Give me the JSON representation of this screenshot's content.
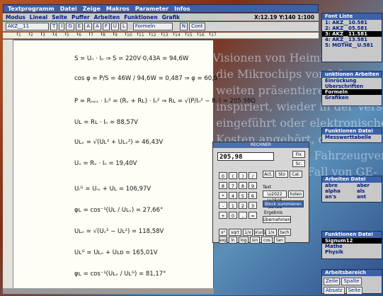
{
  "menu": {
    "items": [
      "Textprogramm",
      "Datei",
      "Zeige",
      "Makros",
      "Parameter",
      "Infos"
    ]
  },
  "toolbar1": {
    "items": [
      "Modus",
      "Lineal",
      "Seite",
      "Puffer",
      "Arbeiten",
      "Funktionen",
      "Grafik"
    ],
    "coords": "X:12.19    Y:140    1:100"
  },
  "toolbar2": {
    "style": "AKZ__11",
    "buttons": [
      "T",
      "I",
      "G",
      "E",
      "A",
      "A",
      "F",
      "U",
      "L"
    ],
    "mode": "Formeln",
    "misc": [
      "N",
      "Cont"
    ]
  },
  "ruler": {
    "labels": [
      "1",
      "2",
      "3",
      "4",
      "5",
      "6",
      "7",
      "8",
      "9",
      "10",
      "11",
      "12",
      "13",
      "14",
      "15",
      "16",
      "17"
    ]
  },
  "equations": [
    "S = Uₙ · Iₙ   ⇒   S = 220V·0,43A = 94,6W",
    "cos φ = P/S = 46W / 94,6W = 0,487 ⇒ φ = 60,9°",
    "P = Rₙₑₓ · Iₙ² = (Rᵥ + Rʟ) · Iₙ² ⇒ Rʟ = √(P/Iₙ² − Rᵥ) = 205,98Ω",
    "Uʟ = Rʟ · Iₙ = 88,57V",
    "Uʟᵥ = √(Uʟ² + Uʟᵥ²) = 46,43V",
    "Uᵥ = Rᵥ · Iₙ = 19,40V",
    "Uᵣᴳ = Uᵣᵥ + Uʟ = 106,97V",
    "φʟ = cos⁻¹(Uʟ / Uʟᵥ) = 27,66°",
    "Uʟᵥ = √(Uᵥ² − Uʟ²) = 118,58V",
    "Uʟᴳ = Uʟᵥ + Uʟᴅ = 165,01V",
    "φʟ = cos⁻¹(Uʟᵥ / Uʟᴳ) = 81,17°"
  ],
  "calculator": {
    "title": "RECHNER",
    "display": "205,98",
    "side_buttons": [
      "Fix",
      "Sc."
    ],
    "keys": [
      "0",
      "(",
      ")",
      "/",
      "8",
      "7",
      "8",
      "9",
      "*",
      "4",
      "5",
      "6",
      "-",
      "1",
      "2",
      "3",
      "+",
      "0",
      ",",
      "="
    ],
    "fn_keys": [
      "Act.",
      "Sto",
      "Cal.",
      "x²",
      "sqrt",
      "1/x",
      "tach",
      "exp",
      "ln",
      "log",
      "sin",
      "cos",
      "tan"
    ],
    "text_buttons": [
      "Text",
      "holen"
    ],
    "block_button": "Block summieren",
    "result_label": "Ergebnis",
    "result_button": "übernehmen"
  },
  "font_panel": {
    "title": "Font  Liste",
    "items": [
      "1: AKZ__10.581",
      "2: AKZ__05.581",
      "3: AKZ__11.581",
      "4: AKZ__13.581",
      "5: MOTHE__U.581"
    ]
  },
  "work_panel": {
    "title": "unktionen  Arbeiten",
    "items": [
      "Einrückung",
      "Überschriften",
      "Formeln",
      "Grafiken"
    ]
  },
  "func_panel": {
    "title": "Funktionen  Datei",
    "items": [
      "Messwerttabelle"
    ]
  },
  "abbrev_panel": {
    "title": "Arbeiten  Datei",
    "left": [
      "abre",
      "alpha",
      "an's"
    ],
    "right": [
      "aber",
      "als",
      "ant"
    ]
  },
  "func_panel2": {
    "title": "Funktionen  Datei",
    "items": [
      "Signum12",
      "Mathe",
      "Physik"
    ]
  },
  "work_area": {
    "title": "Arbeitsbereich",
    "buttons": [
      "Zeile",
      "Spalte",
      "Absatz",
      "Seite"
    ]
  },
  "background_text": "Visionen von Heimrechnern\n die Mikrochips vor Jahren\n weiten präsentieren, den\n inspiriert, wieder in der Versi\n eingeführt oder elektronischen\n Kosten angehört, darauf a\n bei allen Firmen Fahrzeugver\n Electronic, den Fall von GE-"
}
